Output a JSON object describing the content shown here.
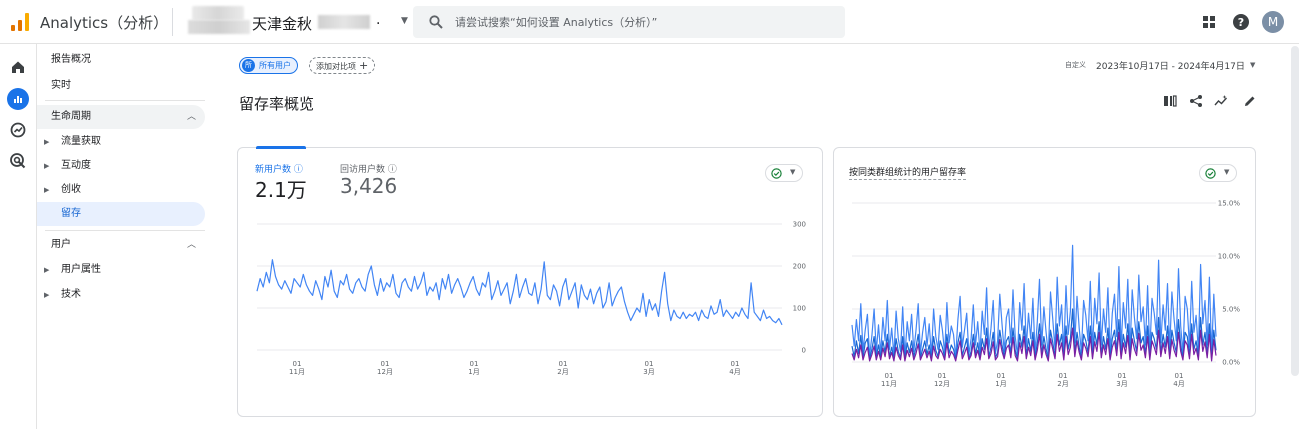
{
  "header": {
    "app_title": "Analytics（分析）",
    "account_name": "天津金秋",
    "account_suffix": ".",
    "search_placeholder": "请尝试搜索“如何设置 Analytics（分析）”",
    "avatar_letter": "M"
  },
  "sidenav": {
    "items": [
      {
        "label": "报告概况"
      },
      {
        "label": "实时"
      },
      {
        "label": "生命周期"
      },
      {
        "label": "流量获取"
      },
      {
        "label": "互动度"
      },
      {
        "label": "创收"
      },
      {
        "label": "留存"
      },
      {
        "label": "用户"
      },
      {
        "label": "用户属性"
      },
      {
        "label": "技术"
      }
    ]
  },
  "toolbar": {
    "segment_badge": "所",
    "segment_label": "所有用户",
    "add_compare_label": "添加对比项",
    "add_compare_plus": "+",
    "date_prefix": "自定义",
    "date_range": "2023年10月17日 - 2024年4月17日"
  },
  "page": {
    "title": "留存率概览"
  },
  "card1": {
    "metric1_label": "新用户数 ⓘ",
    "metric1_value": "2.1万",
    "metric2_label": "回访用户数 ⓘ",
    "metric2_value": "3,426"
  },
  "card2": {
    "title": "按同类群组统计的用户留存率"
  },
  "colors": {
    "accent": "#1a73e8",
    "series1": "#4285f4",
    "series2": "#1967d2",
    "series3": "#7b1fa2",
    "check": "#188038"
  },
  "chart_data": [
    {
      "type": "line",
      "ylim": [
        0,
        300
      ],
      "yticks": [
        "300",
        "200",
        "100",
        "0"
      ],
      "xticks": [
        {
          "day": "01",
          "month": "11月"
        },
        {
          "day": "01",
          "month": "12月"
        },
        {
          "day": "01",
          "month": "1月"
        },
        {
          "day": "01",
          "month": "2月"
        },
        {
          "day": "01",
          "month": "3月"
        },
        {
          "day": "01",
          "month": "4月"
        }
      ],
      "series": [
        {
          "values": [
            140,
            170,
            150,
            185,
            160,
            215,
            175,
            155,
            145,
            165,
            150,
            135,
            170,
            160,
            150,
            180,
            155,
            140,
            130,
            165,
            145,
            120,
            175,
            150,
            190,
            140,
            125,
            165,
            155,
            180,
            145,
            135,
            160,
            170,
            150,
            140,
            180,
            200,
            155,
            130,
            170,
            140,
            160,
            150,
            180,
            135,
            125,
            160,
            170,
            150,
            140,
            175,
            145,
            160,
            185,
            130,
            150,
            140,
            160,
            120,
            170,
            145,
            180,
            135,
            155,
            170,
            150,
            125,
            140,
            160,
            175,
            145,
            130,
            160,
            150,
            185,
            120,
            140,
            165,
            130,
            145,
            160,
            110,
            140,
            180,
            125,
            150,
            170,
            135,
            130,
            160,
            110,
            145,
            210,
            130,
            120,
            155,
            140,
            105,
            150,
            170,
            120,
            140,
            160,
            100,
            155,
            130,
            120,
            145,
            110,
            135,
            150,
            100,
            115,
            160,
            105,
            125,
            140,
            150,
            115,
            90,
            70,
            85,
            100,
            90,
            135,
            80,
            120,
            95,
            110,
            80,
            140,
            185,
            110,
            70,
            95,
            80,
            75,
            90,
            75,
            85,
            80,
            90,
            70,
            95,
            80,
            75,
            105,
            85,
            90,
            120,
            80,
            95,
            85,
            75,
            90,
            80,
            100,
            85,
            75,
            160,
            90,
            80,
            70,
            95,
            75,
            80,
            70,
            65,
            75,
            60
          ]
        }
      ]
    },
    {
      "type": "line",
      "ylim": [
        0,
        15
      ],
      "yticks": [
        "15.0%",
        "10.0%",
        "5.0%",
        "0.0%"
      ],
      "xticks": [
        {
          "day": "01",
          "month": "11月"
        },
        {
          "day": "01",
          "month": "12月"
        },
        {
          "day": "01",
          "month": "1月"
        },
        {
          "day": "01",
          "month": "2月"
        },
        {
          "day": "01",
          "month": "3月"
        },
        {
          "day": "01",
          "month": "4月"
        }
      ],
      "series": [
        {
          "values": [
            3.5,
            1.5,
            4.0,
            2.0,
            5.5,
            1.0,
            3.0,
            4.5,
            0.5,
            2.5,
            5.0,
            1.0,
            3.5,
            0.8,
            4.2,
            2.0,
            5.8,
            1.2,
            3.2,
            0.6,
            4.8,
            2.2,
            1.0,
            5.2,
            0.5,
            3.8,
            2.0,
            4.5,
            1.0,
            3.0,
            5.5,
            0.8,
            2.8,
            4.2,
            1.5,
            3.6,
            0.6,
            5.0,
            2.4,
            1.2,
            4.4,
            3.0,
            0.8,
            5.6,
            1.8,
            3.4,
            2.6,
            0.5,
            4.0,
            6.2,
            1.4,
            3.0,
            4.6,
            0.7,
            2.2,
            5.4,
            1.6,
            3.8,
            0.9,
            4.8,
            2.6,
            7.0,
            1.2,
            3.2,
            5.8,
            0.8,
            2.0,
            6.4,
            3.6,
            1.0,
            4.2,
            5.0,
            1.8,
            6.8,
            2.4,
            0.6,
            5.6,
            3.0,
            7.4,
            1.4,
            4.6,
            2.2,
            6.0,
            0.8,
            3.8,
            7.8,
            1.6,
            5.2,
            2.8,
            0.7,
            6.6,
            4.0,
            1.2,
            8.0,
            3.4,
            5.4,
            1.0,
            7.2,
            2.6,
            4.8,
            11.0,
            1.8,
            6.2,
            3.2,
            0.9,
            5.8,
            4.4,
            2.0,
            7.6,
            1.2,
            6.0,
            3.6,
            8.4,
            1.6,
            5.0,
            2.8,
            7.0,
            0.8,
            4.6,
            6.4,
            2.4,
            9.0,
            1.4,
            5.6,
            3.2,
            7.8,
            1.0,
            6.8,
            4.2,
            2.2,
            8.2,
            3.8,
            5.2,
            1.6,
            7.2,
            0.9,
            6.0,
            4.6,
            2.6,
            9.6,
            1.8,
            5.4,
            3.0,
            7.4,
            1.2,
            6.6,
            4.0,
            2.0,
            8.8,
            3.4,
            0.8,
            6.2,
            5.0,
            1.4,
            7.6,
            2.8,
            4.4,
            1.0,
            9.2,
            3.6,
            5.8,
            1.6,
            8.0,
            0.7,
            6.4,
            2.4
          ]
        },
        {
          "values": [
            1.5,
            0.5,
            2.0,
            0.8,
            2.5,
            0.4,
            1.8,
            2.2,
            0.3,
            1.2,
            2.4,
            0.5,
            1.6,
            0.4,
            2.0,
            0.9,
            2.6,
            0.5,
            1.4,
            0.3,
            2.2,
            1.0,
            0.4,
            2.4,
            0.3,
            1.8,
            0.9,
            2.0,
            0.5,
            1.4,
            2.6,
            0.4,
            1.2,
            2.0,
            0.7,
            1.6,
            0.3,
            2.4,
            1.1,
            0.5,
            2.0,
            1.4,
            0.4,
            2.6,
            0.8,
            1.6,
            1.2,
            0.3,
            1.8,
            2.8,
            0.6,
            1.4,
            2.2,
            0.3,
            1.0,
            2.6,
            0.7,
            1.8,
            0.4,
            2.2,
            1.2,
            3.2,
            0.5,
            1.4,
            2.8,
            0.4,
            0.9,
            3.0,
            1.6,
            0.5,
            2.0,
            2.4,
            0.8,
            3.2,
            1.1,
            0.3,
            2.6,
            1.4,
            3.4,
            0.6,
            2.2,
            1.0,
            2.8,
            0.4,
            1.8,
            3.6,
            0.7,
            2.4,
            1.2,
            0.3,
            3.0,
            1.8,
            0.5,
            3.6,
            1.6,
            2.6,
            0.4,
            3.4,
            1.2,
            2.2,
            5.0,
            0.8,
            2.8,
            1.4,
            0.4,
            2.6,
            2.0,
            0.9,
            3.4,
            0.5,
            2.8,
            1.6,
            3.8,
            0.7,
            2.4,
            1.2,
            3.2,
            0.4,
            2.2,
            3.0,
            1.1,
            4.0,
            0.6,
            2.6,
            1.4,
            3.6,
            0.5,
            3.2,
            2.0,
            1.0,
            3.8,
            1.8,
            2.4,
            0.7,
            3.4,
            0.4,
            2.8,
            2.2,
            1.2,
            4.2,
            0.8,
            2.6,
            1.4,
            3.4,
            0.5,
            3.0,
            1.8,
            0.9,
            4.0,
            1.6,
            0.4,
            2.8,
            2.4,
            0.6,
            3.6,
            1.2,
            2.0,
            0.5,
            4.2,
            1.6,
            2.8,
            0.7,
            3.6,
            0.3,
            3.0,
            1.1
          ]
        },
        {
          "values": [
            0.8,
            0.2,
            1.2,
            0.4,
            1.6,
            0.2,
            0.9,
            1.4,
            0.1,
            0.7,
            1.5,
            0.2,
            1.0,
            0.2,
            1.3,
            0.5,
            1.8,
            0.3,
            0.9,
            0.1,
            1.4,
            0.6,
            0.2,
            1.6,
            0.1,
            1.1,
            0.5,
            1.3,
            0.2,
            0.8,
            1.7,
            0.2,
            0.7,
            1.2,
            0.4,
            1.0,
            0.1,
            1.5,
            0.6,
            0.3,
            1.2,
            0.8,
            0.2,
            1.8,
            0.4,
            1.0,
            0.7,
            0.1,
            1.1,
            2.0,
            0.3,
            0.8,
            1.4,
            0.2,
            0.6,
            1.8,
            0.4,
            1.1,
            0.2,
            1.4,
            0.7,
            2.2,
            0.3,
            0.8,
            1.9,
            0.2,
            0.5,
            2.1,
            1.0,
            0.3,
            1.3,
            1.6,
            0.4,
            2.3,
            0.6,
            0.1,
            1.8,
            0.8,
            2.4,
            0.3,
            1.4,
            0.6,
            2.0,
            0.2,
            1.1,
            2.6,
            0.4,
            1.6,
            0.7,
            0.1,
            2.2,
            1.2,
            0.3,
            2.6,
            1.0,
            1.8,
            0.2,
            2.4,
            0.7,
            1.4,
            3.2,
            0.5,
            2.0,
            0.9,
            0.2,
            1.8,
            1.3,
            0.5,
            2.4,
            0.3,
            1.9,
            1.0,
            2.8,
            0.4,
            1.6,
            0.7,
            2.2,
            0.2,
            1.4,
            2.0,
            0.6,
            2.8,
            0.3,
            1.8,
            0.8,
            2.5,
            0.2,
            2.2,
            1.2,
            0.6,
            2.7,
            1.1,
            1.6,
            0.4,
            2.4,
            0.2,
            2.0,
            1.4,
            0.7,
            3.0,
            0.5,
            1.8,
            0.8,
            2.4,
            0.3,
            2.1,
            1.1,
            0.5,
            2.8,
            1.0,
            0.2,
            2.0,
            1.6,
            0.3,
            2.6,
            0.7,
            1.3,
            0.2,
            3.0,
            1.0,
            1.9,
            0.4,
            2.6,
            0.1,
            2.1,
            0.6
          ]
        }
      ]
    }
  ]
}
